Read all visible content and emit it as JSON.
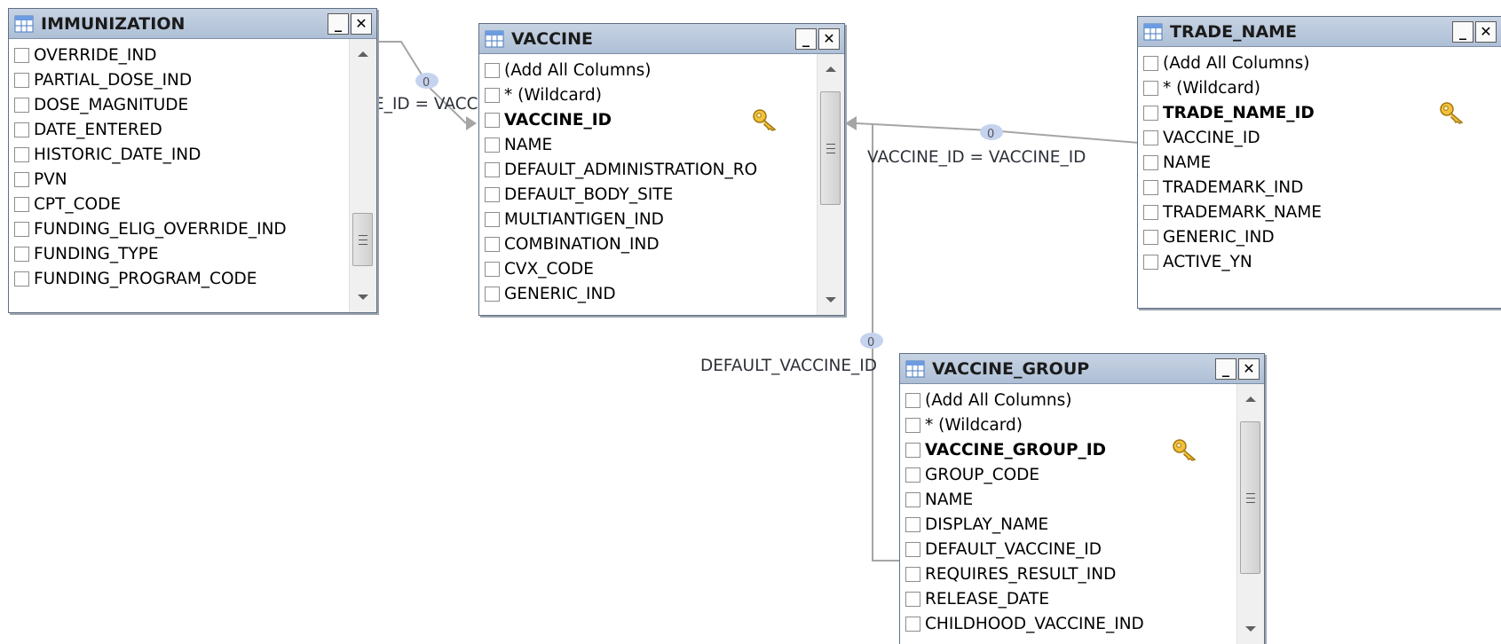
{
  "windows": {
    "immunization": {
      "title": "IMMUNIZATION",
      "rows": [
        "OVERRIDE_IND",
        "PARTIAL_DOSE_IND",
        "DOSE_MAGNITUDE",
        "DATE_ENTERED",
        "HISTORIC_DATE_IND",
        "PVN",
        "CPT_CODE",
        "FUNDING_ELIG_OVERRIDE_IND",
        "FUNDING_TYPE",
        "FUNDING_PROGRAM_CODE"
      ]
    },
    "vaccine": {
      "title": "VACCINE",
      "rows": [
        "(Add All Columns)",
        "* (Wildcard)",
        "VACCINE_ID",
        "NAME",
        "DEFAULT_ADMINISTRATION_RO",
        "DEFAULT_BODY_SITE",
        "MULTIANTIGEN_IND",
        "COMBINATION_IND",
        "CVX_CODE",
        "GENERIC_IND"
      ],
      "pk_index": 2
    },
    "trade_name": {
      "title": "TRADE_NAME",
      "rows": [
        "(Add All Columns)",
        "* (Wildcard)",
        "TRADE_NAME_ID",
        "VACCINE_ID",
        "NAME",
        "TRADEMARK_IND",
        "TRADEMARK_NAME",
        "GENERIC_IND",
        "ACTIVE_YN"
      ],
      "pk_index": 2
    },
    "vaccine_group": {
      "title": "VACCINE_GROUP",
      "rows": [
        "(Add All Columns)",
        "* (Wildcard)",
        "VACCINE_GROUP_ID",
        "GROUP_CODE",
        "NAME",
        "DISPLAY_NAME",
        "DEFAULT_VACCINE_ID",
        "REQUIRES_RESULT_IND",
        "RELEASE_DATE",
        "CHILDHOOD_VACCINE_IND"
      ],
      "pk_index": 2
    }
  },
  "joins": {
    "immunization_vaccine": "E_ID = VACC",
    "trade_name_vaccine": "VACCINE_ID = VACCINE_ID",
    "vaccine_group_vaccine": "DEFAULT_VACCINE_ID"
  },
  "colors": {
    "titlebar": "#aebfd6",
    "connector": "#a5a5a5",
    "join_marker": "#c5d3ef"
  }
}
